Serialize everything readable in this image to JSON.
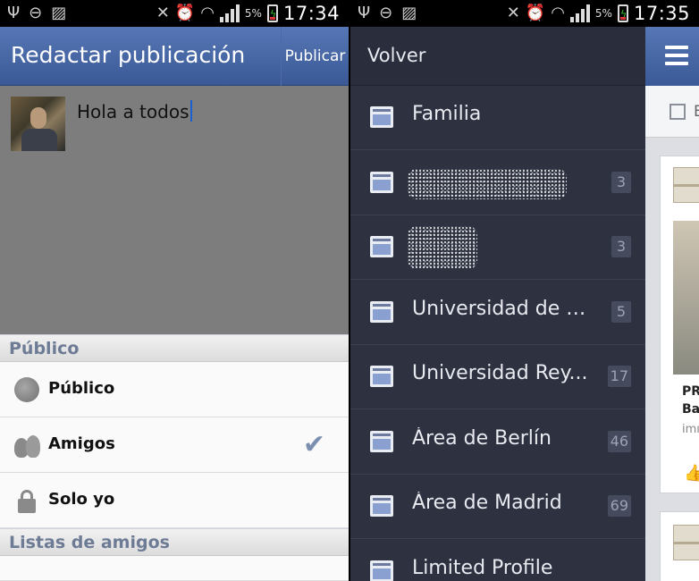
{
  "left_status": {
    "time": "17:34",
    "battery": "5%"
  },
  "right_status": {
    "time": "17:35",
    "battery": "5%"
  },
  "compose": {
    "title": "Redactar publicación",
    "publish_label": "Publicar",
    "text": "Hola a todos"
  },
  "audience": {
    "section_public": "Público",
    "options": [
      {
        "label": "Público",
        "icon": "globe-icon",
        "selected": false
      },
      {
        "label": "Amigos",
        "icon": "friends-icon",
        "selected": true
      },
      {
        "label": "Solo yo",
        "icon": "lock-icon",
        "selected": false
      }
    ],
    "section_lists": "Listas de amigos"
  },
  "groups_menu": {
    "back_label": "Volver",
    "items": [
      {
        "name": "Familia",
        "count": ""
      },
      {
        "name": "",
        "count": "3",
        "blurred": true
      },
      {
        "name": "",
        "count": "3",
        "blurred": true
      },
      {
        "name": "Universidad de M...",
        "count": "5"
      },
      {
        "name": "Universidad Rey...",
        "count": "17"
      },
      {
        "name": "Área de Berlín",
        "count": "46"
      },
      {
        "name": "Área de Madrid",
        "count": "69"
      },
      {
        "name": "Limited Profile",
        "count": ""
      }
    ]
  },
  "feed_peek": {
    "tab_letter": "E",
    "card_text_1": "PR",
    "card_text_2": "Ba",
    "card_sub": "imı"
  },
  "colors": {
    "facebook_blue": "#3b5998",
    "menu_bg": "#2d3140",
    "compose_bg": "#7d7d7d"
  }
}
